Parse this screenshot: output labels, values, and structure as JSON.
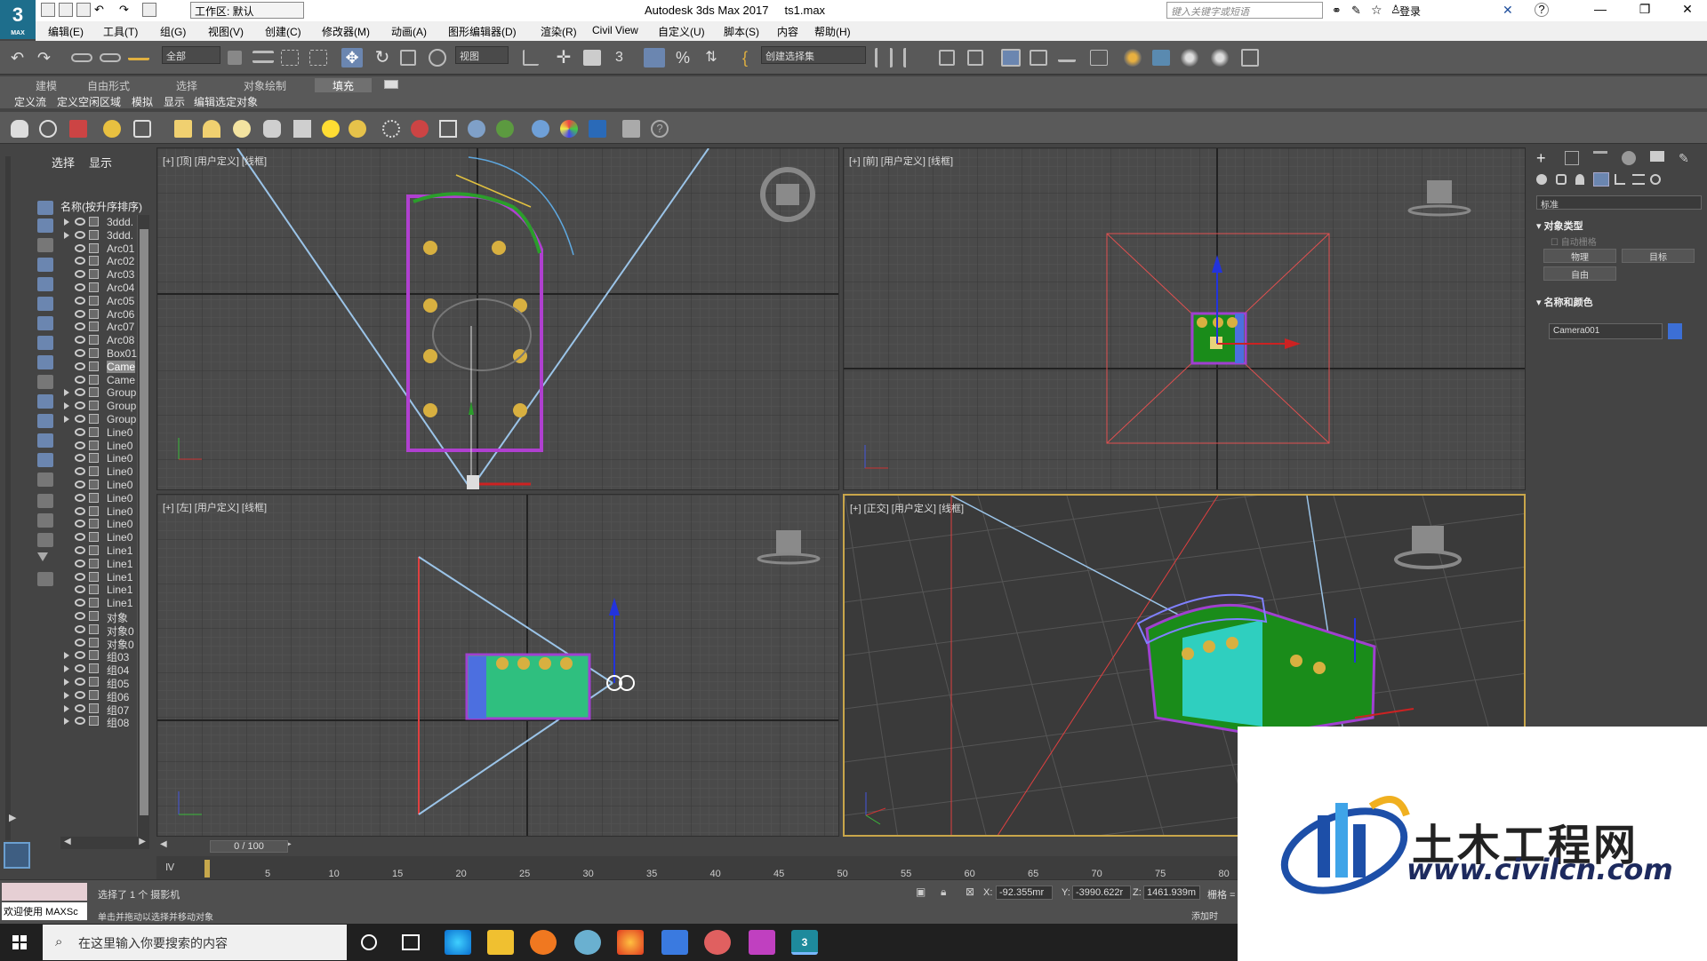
{
  "app": {
    "window_title": "Autodesk 3ds Max 2017",
    "file_name": "ts1.max",
    "logo_text": "3",
    "logo_sub": "MAX",
    "workspace": "工作区: 默认",
    "search_placeholder": "键入关键字或短语",
    "login": "登录"
  },
  "menu": [
    "编辑(E)",
    "工具(T)",
    "组(G)",
    "视图(V)",
    "创建(C)",
    "修改器(M)",
    "动画(A)",
    "图形编辑器(D)",
    "渲染(R)",
    "Civil View",
    "自定义(U)",
    "脚本(S)",
    "内容",
    "帮助(H)"
  ],
  "toolbar": {
    "selection_filter": "全部",
    "ref_coord": "视图",
    "named_selection": "创建选择集"
  },
  "ribbon_tabs": [
    "建模",
    "自由形式",
    "选择",
    "对象绘制",
    "填充"
  ],
  "ribbon_subtabs": [
    "定义流",
    "定义空闲区域",
    "模拟",
    "显示",
    "编辑选定对象"
  ],
  "scene_explorer": {
    "tabs": [
      "选择",
      "显示"
    ],
    "column_header": "名称(按升序排序)",
    "items": [
      {
        "name": "3ddd.",
        "expand": true
      },
      {
        "name": "3ddd.",
        "expand": true
      },
      {
        "name": "Arc01",
        "expand": false
      },
      {
        "name": "Arc02",
        "expand": false
      },
      {
        "name": "Arc03",
        "expand": false
      },
      {
        "name": "Arc04",
        "expand": false
      },
      {
        "name": "Arc05",
        "expand": false
      },
      {
        "name": "Arc06",
        "expand": false
      },
      {
        "name": "Arc07",
        "expand": false
      },
      {
        "name": "Arc08",
        "expand": false
      },
      {
        "name": "Box01",
        "expand": false
      },
      {
        "name": "Came",
        "expand": false,
        "selected": true
      },
      {
        "name": "Came",
        "expand": false
      },
      {
        "name": "Group",
        "expand": true
      },
      {
        "name": "Group",
        "expand": true
      },
      {
        "name": "Group",
        "expand": true
      },
      {
        "name": "Line0",
        "expand": false
      },
      {
        "name": "Line0",
        "expand": false
      },
      {
        "name": "Line0",
        "expand": false
      },
      {
        "name": "Line0",
        "expand": false
      },
      {
        "name": "Line0",
        "expand": false
      },
      {
        "name": "Line0",
        "expand": false
      },
      {
        "name": "Line0",
        "expand": false
      },
      {
        "name": "Line0",
        "expand": false
      },
      {
        "name": "Line0",
        "expand": false
      },
      {
        "name": "Line1",
        "expand": false
      },
      {
        "name": "Line1",
        "expand": false
      },
      {
        "name": "Line1",
        "expand": false
      },
      {
        "name": "Line1",
        "expand": false
      },
      {
        "name": "Line1",
        "expand": false
      },
      {
        "name": "对象",
        "expand": false
      },
      {
        "name": "对象0",
        "expand": false
      },
      {
        "name": "对象0",
        "expand": false
      },
      {
        "name": "组03",
        "expand": true
      },
      {
        "name": "组04",
        "expand": true
      },
      {
        "name": "组05",
        "expand": true
      },
      {
        "name": "组06",
        "expand": true
      },
      {
        "name": "组07",
        "expand": true
      },
      {
        "name": "组08",
        "expand": true
      }
    ]
  },
  "viewports": [
    {
      "label": "[+] [顶] [用户定义] [线框]"
    },
    {
      "label": "[+] [前] [用户定义] [线框]"
    },
    {
      "label": "[+] [左] [用户定义] [线框]"
    },
    {
      "label": "[+] [正交] [用户定义] [线框]"
    }
  ],
  "command_panel": {
    "dropdown": "标准",
    "rollout1": "对象类型",
    "auto_grid": "自动栅格",
    "buttons": [
      "物理",
      "目标",
      "自由"
    ],
    "rollout2": "名称和颜色",
    "object_name": "Camera001",
    "object_color": "#3c6fd6"
  },
  "timeline": {
    "slider": "0 / 100",
    "ticks": [
      "5",
      "10",
      "15",
      "20",
      "25",
      "30",
      "35",
      "40",
      "45",
      "50",
      "55",
      "60",
      "65",
      "70",
      "75",
      "80"
    ]
  },
  "status": {
    "selected": "选择了 1 个 摄影机",
    "hint": "单击并拖动以选择并移动对象",
    "welcome": "欢迎使用 MAXSc",
    "x_label": "X:",
    "x_value": "-92.355mr",
    "y_label": "Y:",
    "y_value": "-3990.622r",
    "z_label": "Z:",
    "z_value": "1461.939m",
    "grid_label": "栅格 =",
    "add_label": "添加时"
  },
  "taskbar": {
    "search_placeholder": "在这里输入你要搜索的内容"
  },
  "watermark": {
    "title": "土木工程网",
    "url": "www.civilcn.com"
  }
}
